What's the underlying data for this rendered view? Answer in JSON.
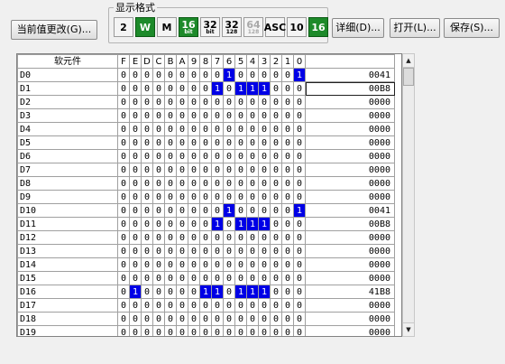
{
  "toolbar": {
    "change_label": "当前值更改(G)...",
    "format_group_title": "显示格式",
    "detail_label": "详细(D)...",
    "open_label": "打开(L)...",
    "save_label": "保存(S)...",
    "format_buttons": [
      {
        "name": "format-bin-2",
        "big": "2",
        "small": "",
        "style": "normal"
      },
      {
        "name": "format-word-w",
        "big": "W",
        "small": "",
        "style": "green"
      },
      {
        "name": "format-wave-m",
        "big": "M",
        "small": "",
        "style": "normal"
      },
      {
        "name": "format-16bit",
        "big": "16",
        "small": "bit",
        "style": "green"
      },
      {
        "name": "format-32bit",
        "big": "32",
        "small": "bit",
        "style": "normal"
      },
      {
        "name": "format-32-128",
        "big": "32",
        "small": "128",
        "style": "normal"
      },
      {
        "name": "format-64-disabled",
        "big": "64",
        "small": "128",
        "style": "gray"
      },
      {
        "name": "format-asc",
        "big": "ASC",
        "small": "",
        "style": "normal"
      },
      {
        "name": "format-dec-10",
        "big": "10",
        "small": "",
        "style": "normal"
      },
      {
        "name": "format-hex-16",
        "big": "16",
        "small": "",
        "style": "green"
      }
    ]
  },
  "table": {
    "name_header": "软元件",
    "bit_headers": [
      "F",
      "E",
      "D",
      "C",
      "B",
      "A",
      "9",
      "8",
      "7",
      "6",
      "5",
      "4",
      "3",
      "2",
      "1",
      "0"
    ],
    "rows": [
      {
        "device": "D0",
        "value": "0041"
      },
      {
        "device": "D1",
        "value": "00B8"
      },
      {
        "device": "D2",
        "value": "0000"
      },
      {
        "device": "D3",
        "value": "0000"
      },
      {
        "device": "D4",
        "value": "0000"
      },
      {
        "device": "D5",
        "value": "0000"
      },
      {
        "device": "D6",
        "value": "0000"
      },
      {
        "device": "D7",
        "value": "0000"
      },
      {
        "device": "D8",
        "value": "0000"
      },
      {
        "device": "D9",
        "value": "0000"
      },
      {
        "device": "D10",
        "value": "0041"
      },
      {
        "device": "D11",
        "value": "00B8"
      },
      {
        "device": "D12",
        "value": "0000"
      },
      {
        "device": "D13",
        "value": "0000"
      },
      {
        "device": "D14",
        "value": "0000"
      },
      {
        "device": "D15",
        "value": "0000"
      },
      {
        "device": "D16",
        "value": "41B8"
      },
      {
        "device": "D17",
        "value": "0000"
      },
      {
        "device": "D18",
        "value": "0000"
      },
      {
        "device": "D19",
        "value": "0000"
      }
    ],
    "selected_row": 1,
    "on_color": "#0000e6"
  },
  "icons": {
    "scroll_up": "▲",
    "scroll_down": "▼"
  }
}
